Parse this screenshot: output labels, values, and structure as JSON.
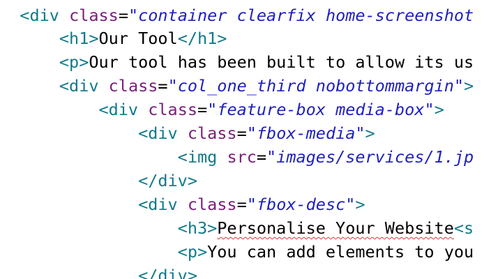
{
  "code_editor": {
    "lines": [
      {
        "indent": "  ",
        "open": "<",
        "tag": "div",
        "space": " ",
        "attr": "class",
        "eq": "=",
        "q1": "\"",
        "value": "container clearfix home-screenshot",
        "q2": "",
        "close": "",
        "text": "",
        "end_open": "",
        "end_tag": "",
        "end_close": ""
      },
      {
        "indent": "      ",
        "open": "<",
        "tag": "h1",
        "space": "",
        "attr": "",
        "eq": "",
        "q1": "",
        "value": "",
        "q2": "",
        "close": ">",
        "text": "Our Tool",
        "end_open": "</",
        "end_tag": "h1",
        "end_close": ">"
      },
      {
        "indent": "      ",
        "open": "<",
        "tag": "p",
        "space": "",
        "attr": "",
        "eq": "",
        "q1": "",
        "value": "",
        "q2": "",
        "close": ">",
        "text": "Our tool has been built to allow its us",
        "end_open": "",
        "end_tag": "",
        "end_close": ""
      },
      {
        "indent": "      ",
        "open": "<",
        "tag": "div",
        "space": " ",
        "attr": "class",
        "eq": "=",
        "q1": "\"",
        "value": "col_one_third nobottommargin",
        "q2": "\"",
        "close": ">",
        "text": "",
        "end_open": "",
        "end_tag": "",
        "end_close": ""
      },
      {
        "indent": "          ",
        "open": "<",
        "tag": "div",
        "space": " ",
        "attr": "class",
        "eq": "=",
        "q1": "\"",
        "value": "feature-box media-box",
        "q2": "\"",
        "close": ">",
        "text": "",
        "end_open": "",
        "end_tag": "",
        "end_close": ""
      },
      {
        "indent": "              ",
        "open": "<",
        "tag": "div",
        "space": " ",
        "attr": "class",
        "eq": "=",
        "q1": "\"",
        "value": "fbox-media",
        "q2": "\"",
        "close": ">",
        "text": "",
        "end_open": "",
        "end_tag": "",
        "end_close": ""
      },
      {
        "indent": "                  ",
        "open": "<",
        "tag": "img",
        "space": " ",
        "attr": "src",
        "eq": "=",
        "q1": "\"",
        "value": "images/services/1.jp",
        "q2": "",
        "close": "",
        "text": "",
        "end_open": "",
        "end_tag": "",
        "end_close": ""
      },
      {
        "indent": "              ",
        "open": "</",
        "tag": "div",
        "space": "",
        "attr": "",
        "eq": "",
        "q1": "",
        "value": "",
        "q2": "",
        "close": ">",
        "text": "",
        "end_open": "",
        "end_tag": "",
        "end_close": ""
      },
      {
        "indent": "              ",
        "open": "<",
        "tag": "div",
        "space": " ",
        "attr": "class",
        "eq": "=",
        "q1": "\"",
        "value": "fbox-desc",
        "q2": "\"",
        "close": ">",
        "text": "",
        "end_open": "",
        "end_tag": "",
        "end_close": ""
      },
      {
        "indent": "                  ",
        "open": "<",
        "tag": "h3",
        "space": "",
        "attr": "",
        "eq": "",
        "q1": "",
        "value": "",
        "q2": "",
        "close": ">",
        "text": "Personalise Your Website",
        "end_open": "<",
        "end_tag": "s",
        "end_close": ""
      },
      {
        "indent": "                  ",
        "open": "<",
        "tag": "p",
        "space": "",
        "attr": "",
        "eq": "",
        "q1": "",
        "value": "",
        "q2": "",
        "close": ">",
        "text": "You can add elements to you",
        "end_open": "",
        "end_tag": "",
        "end_close": ""
      },
      {
        "indent": "              ",
        "open": "</",
        "tag": "div",
        "space": "",
        "attr": "",
        "eq": "",
        "q1": "",
        "value": "",
        "q2": "",
        "close": ">",
        "text": "",
        "end_open": "",
        "end_tag": "",
        "end_close": ""
      }
    ]
  },
  "colors": {
    "background": "#ffffff",
    "tag_punctuation": "#0f7a8a",
    "attribute_name": "#7a1e7a",
    "attribute_value": "#1f1fbf",
    "text": "#000000",
    "spellcheck_squiggle": "#d23a3a"
  }
}
